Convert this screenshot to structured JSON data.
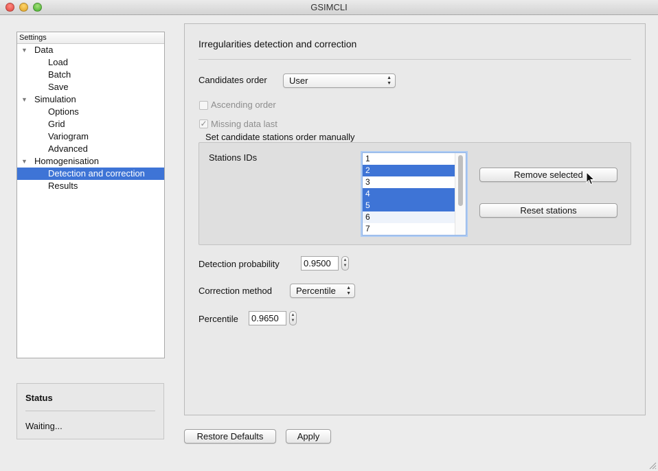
{
  "window": {
    "title": "GSIMCLI"
  },
  "tree": {
    "header": "Settings",
    "items": [
      {
        "label": "Data",
        "level": 0
      },
      {
        "label": "Load",
        "level": 1
      },
      {
        "label": "Batch",
        "level": 1
      },
      {
        "label": "Save",
        "level": 1
      },
      {
        "label": "Simulation",
        "level": 0
      },
      {
        "label": "Options",
        "level": 1
      },
      {
        "label": "Grid",
        "level": 1
      },
      {
        "label": "Variogram",
        "level": 1
      },
      {
        "label": "Advanced",
        "level": 1
      },
      {
        "label": "Homogenisation",
        "level": 0
      },
      {
        "label": "Detection and correction",
        "level": 1,
        "selected": true
      },
      {
        "label": "Results",
        "level": 1
      }
    ]
  },
  "status": {
    "title": "Status",
    "text": "Waiting..."
  },
  "panel": {
    "title": "Irregularities detection and correction",
    "candidates_order": {
      "label": "Candidates order",
      "value": "User"
    },
    "ascending_order": {
      "label": "Ascending order",
      "checked": false
    },
    "missing_data_last": {
      "label": "Missing data last",
      "checked": true
    },
    "manual_group": {
      "title": "Set candidate stations order manually",
      "stations_label": "Stations IDs",
      "stations": [
        {
          "id": "1",
          "selected": false
        },
        {
          "id": "2",
          "selected": true
        },
        {
          "id": "3",
          "selected": false
        },
        {
          "id": "4",
          "selected": true
        },
        {
          "id": "5",
          "selected": true
        },
        {
          "id": "6",
          "selected": false
        },
        {
          "id": "7",
          "selected": false
        }
      ],
      "remove_button": "Remove selected",
      "reset_button": "Reset stations"
    },
    "detection_probability": {
      "label": "Detection probability",
      "value": "0.9500"
    },
    "correction_method": {
      "label": "Correction method",
      "value": "Percentile"
    },
    "percentile": {
      "label": "Percentile",
      "value": "0.9650"
    }
  },
  "footer": {
    "restore_defaults": "Restore Defaults",
    "apply": "Apply"
  },
  "colors": {
    "selection": "#3e74d6",
    "focus_ring": "#aecbf3"
  },
  "icons": {
    "close": "close-window-icon",
    "minimize": "minimize-window-icon",
    "zoom": "zoom-window-icon",
    "disclosure": "disclosure-triangle-icon",
    "combo": "combo-arrows-icon",
    "stepper": "stepper-arrows-icon",
    "cursor": "mouse-pointer-icon",
    "resize": "resize-grip-icon"
  }
}
